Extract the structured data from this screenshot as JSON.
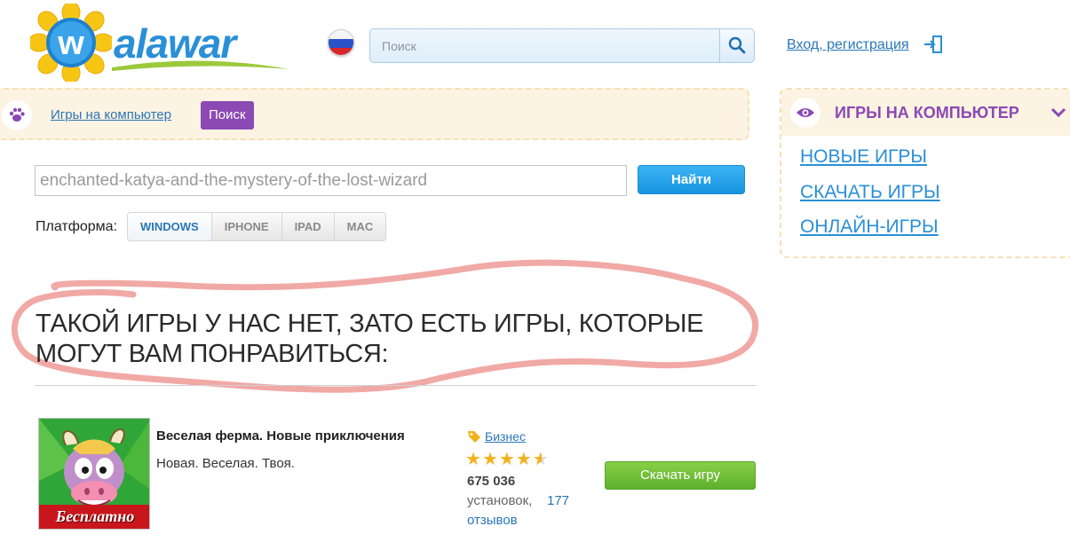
{
  "header": {
    "logo_text": "alawar",
    "search_placeholder": "Поиск",
    "login_label": "Вход, регистрация"
  },
  "breadcrumb": {
    "link_label": "Игры на компьютер",
    "current_label": "Поиск"
  },
  "search": {
    "query_value": "enchanted-katya-and-the-mystery-of-the-lost-wizard",
    "find_button_label": "Найти",
    "platform_label": "Платформа:",
    "platforms": [
      "WINDOWS",
      "IPHONE",
      "IPAD",
      "MAC"
    ],
    "active_platform": "WINDOWS"
  },
  "message": {
    "text": "Такой игры у нас нет, зато есть игры, которые могут вам понравиться:"
  },
  "game": {
    "title": "Веселая ферма. Новые приключения",
    "description": "Новая. Веселая. Твоя.",
    "free_badge": "Бесплатно",
    "category": "Бизнес",
    "rating": 4.5,
    "installs_count": "675 036",
    "installs_label": "установок,",
    "reviews_count": "177",
    "reviews_label": "отзывов",
    "download_label": "Скачать игру"
  },
  "sidebar": {
    "title": "ИГРЫ НА КОМПЬЮТЕР",
    "links": [
      "НОВЫЕ ИГРЫ",
      "СКАЧАТЬ ИГРЫ",
      "ОНЛАЙН-ИГРЫ"
    ]
  },
  "colors": {
    "link": "#2a76b8",
    "accent_purple": "#8b49b4",
    "find_button": "#1595e0",
    "download_button": "#5fb12e",
    "highlight_scribble": "#f0a4a0",
    "panel_bg": "#fdf3e2",
    "star": "#f3b21a"
  },
  "icons": {
    "flag": "russia-flag-icon",
    "search": "magnifier-icon",
    "login": "sign-in-icon",
    "breadcrumb": "paw-icon",
    "tag": "tag-icon",
    "sidebar": "eye-icon",
    "chevron": "chevron-down-icon"
  }
}
